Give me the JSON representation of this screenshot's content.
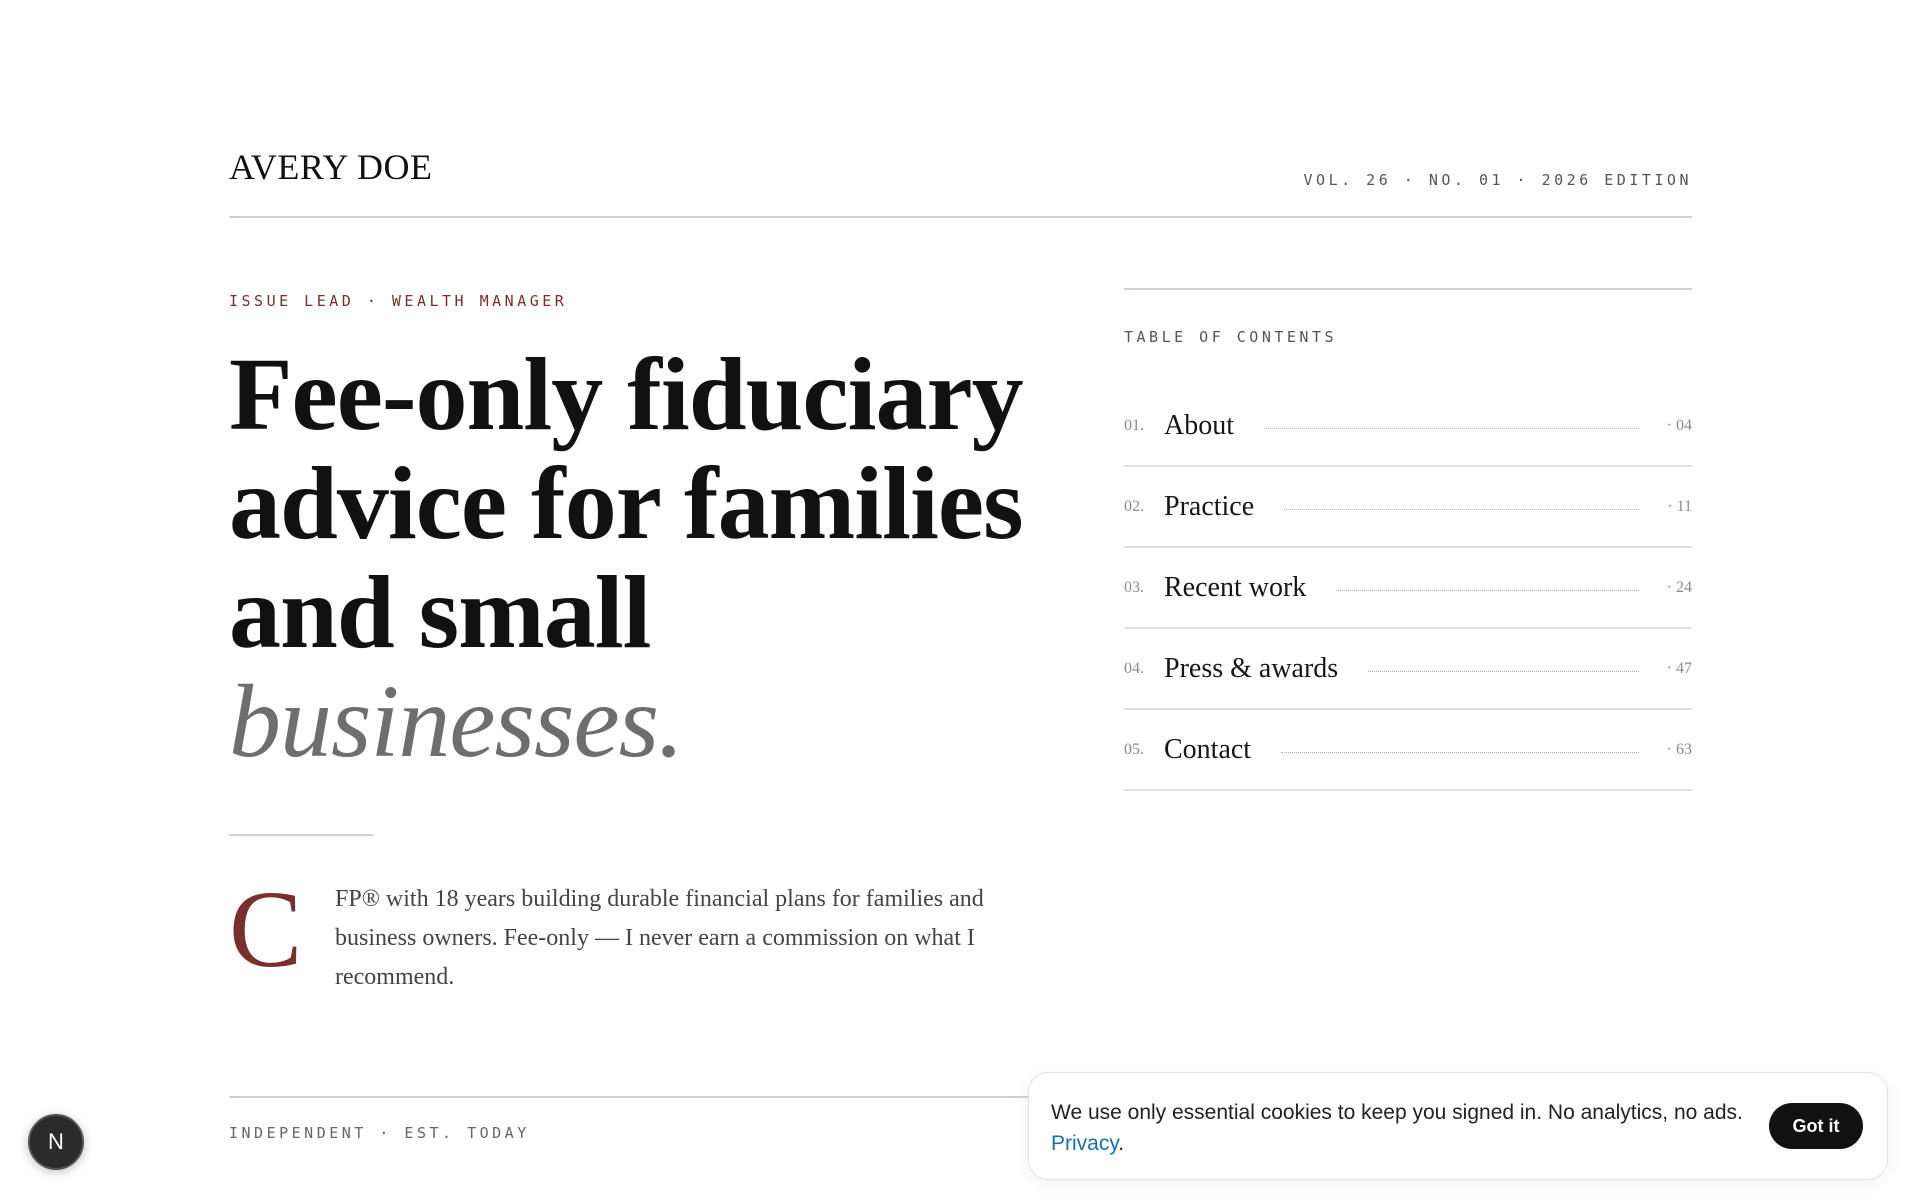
{
  "header": {
    "brand": "AVERY DOE",
    "edition": "VOL. 26 · NO. 01 · 2026 EDITION"
  },
  "hero": {
    "kicker": "ISSUE LEAD · WEALTH MANAGER",
    "headline_main": "Fee-only fiduciary advice for families and small",
    "headline_emphasis": "businesses."
  },
  "intro": {
    "dropcap": "C",
    "text": "FP® with 18 years building durable financial plans for families and business owners. Fee-only — I never earn a commission on what I recommend."
  },
  "toc": {
    "label": "TABLE OF CONTENTS",
    "items": [
      {
        "num": "01.",
        "title": "About",
        "page": "· 04"
      },
      {
        "num": "02.",
        "title": "Practice",
        "page": "· 11"
      },
      {
        "num": "03.",
        "title": "Recent work",
        "page": "· 24"
      },
      {
        "num": "04.",
        "title": "Press & awards",
        "page": "· 47"
      },
      {
        "num": "05.",
        "title": "Contact",
        "page": "· 63"
      }
    ]
  },
  "footer": {
    "note": "INDEPENDENT · EST. TODAY"
  },
  "cookie": {
    "text": "We use only essential cookies to keep you signed in. No analytics, no ads.",
    "link": "Privacy",
    "period": ".",
    "button": "Got it"
  },
  "badge": {
    "letter": "N",
    "icon": "nextjs-icon"
  }
}
